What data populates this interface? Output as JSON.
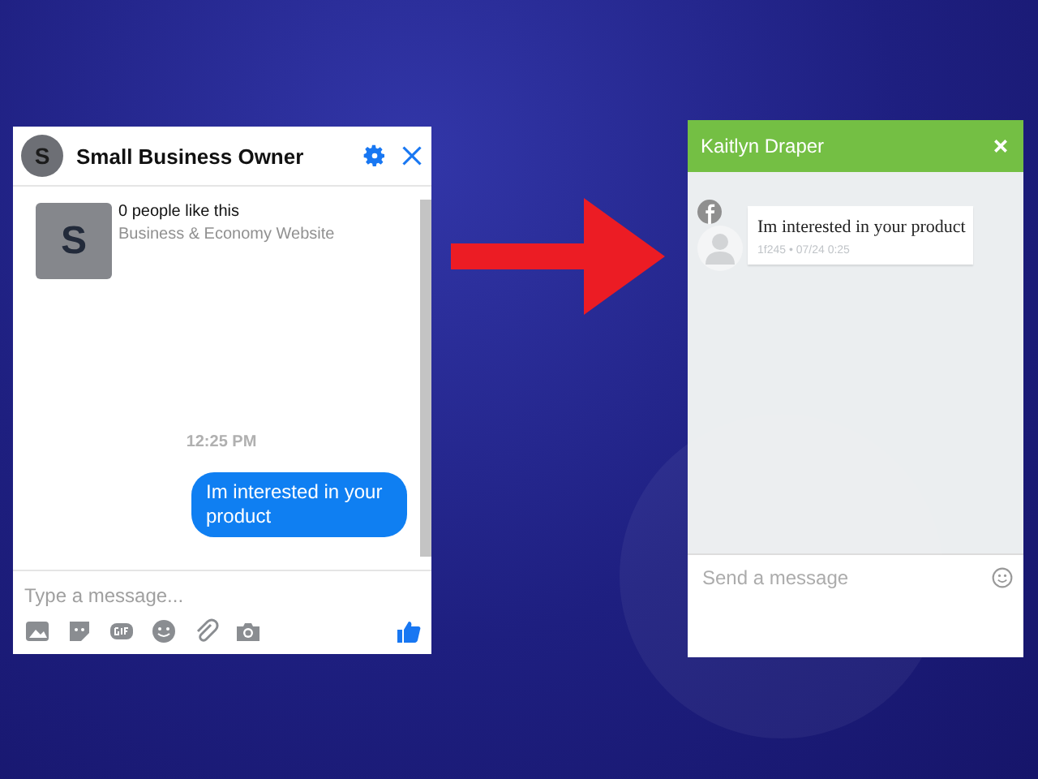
{
  "messenger_chat": {
    "avatar_letter": "S",
    "title": "Small Business Owner",
    "page_card": {
      "avatar_letter": "S",
      "likes": "0 people like this",
      "category": "Business & Economy Website"
    },
    "timestamp": "12:25 PM",
    "message": "Im interested in your product",
    "placeholder": "Type a message..."
  },
  "widget_chat": {
    "title": "Kaitlyn Draper",
    "message": "Im interested in your product",
    "meta": "1f245 • 07/24 0:25",
    "placeholder": "Send a message"
  }
}
